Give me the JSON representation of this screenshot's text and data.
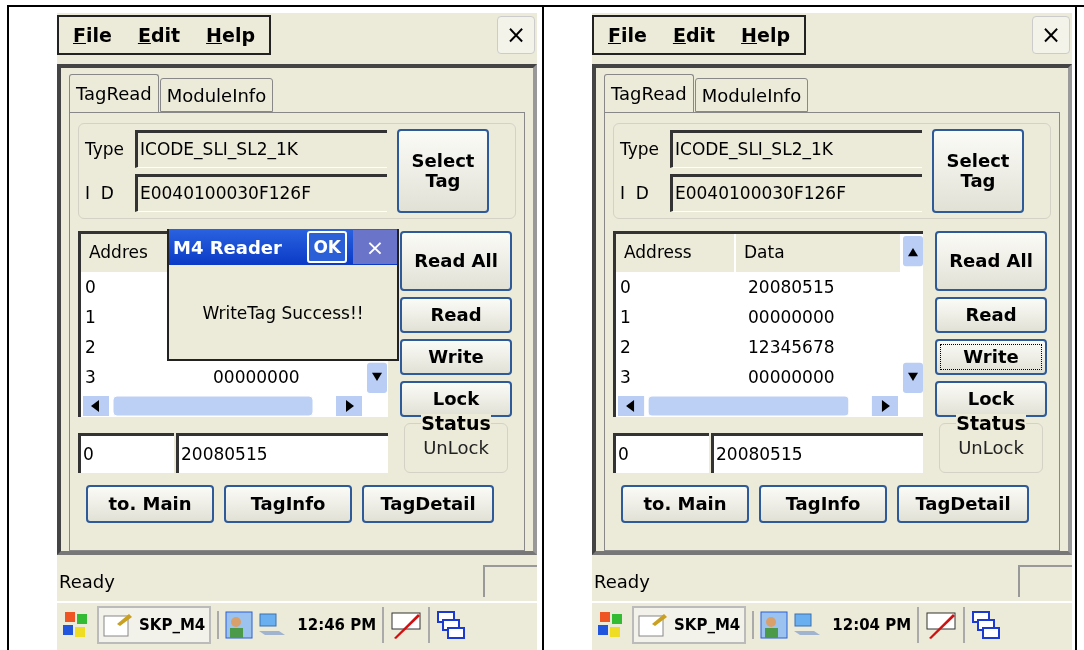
{
  "screens": [
    {
      "menu": [
        "File",
        "Edit",
        "Help"
      ],
      "close": "×",
      "tabs": [
        {
          "label": "TagRead",
          "selected": true
        },
        {
          "label": "ModuleInfo",
          "selected": false
        }
      ],
      "type_label": "Type",
      "type_value": "ICODE_SLI_SL2_1K",
      "id_label": "I  D",
      "id_value": "E0040100030F126F",
      "select_button": "Select Tag",
      "list": {
        "columns": [
          "Addres"
        ],
        "rows": [
          {
            "address": "0"
          },
          {
            "address": "1"
          },
          {
            "address": "2"
          },
          {
            "address": "3",
            "data": "00000000"
          }
        ]
      },
      "actions": [
        {
          "label": "Read All",
          "focused": false
        },
        {
          "label": "Read",
          "focused": false
        },
        {
          "label": "Write",
          "focused": false
        },
        {
          "label": "Lock",
          "focused": false
        }
      ],
      "status_label": "Status",
      "status_value": "UnLock",
      "address_field": "0",
      "data_field": "20080515",
      "bottom_buttons": [
        "to. Main",
        "TagInfo",
        "TagDetail"
      ],
      "status_bar": "Ready",
      "taskbar": {
        "app": "SKP_M4",
        "time": "12:46 PM"
      },
      "dialog": {
        "title": "M4 Reader",
        "ok": "OK",
        "close": "×",
        "message": "WriteTag Success!!"
      }
    },
    {
      "menu": [
        "File",
        "Edit",
        "Help"
      ],
      "close": "×",
      "tabs": [
        {
          "label": "TagRead",
          "selected": true
        },
        {
          "label": "ModuleInfo",
          "selected": false
        }
      ],
      "type_label": "Type",
      "type_value": "ICODE_SLI_SL2_1K",
      "id_label": "I  D",
      "id_value": "E0040100030F126F",
      "select_button": "Select Tag",
      "list": {
        "columns": [
          "Address",
          "Data"
        ],
        "rows": [
          {
            "address": "0",
            "data": "20080515"
          },
          {
            "address": "1",
            "data": "00000000"
          },
          {
            "address": "2",
            "data": "12345678"
          },
          {
            "address": "3",
            "data": "00000000"
          }
        ]
      },
      "actions": [
        {
          "label": "Read All",
          "focused": false
        },
        {
          "label": "Read",
          "focused": false
        },
        {
          "label": "Write",
          "focused": true
        },
        {
          "label": "Lock",
          "focused": false
        }
      ],
      "status_label": "Status",
      "status_value": "UnLock",
      "address_field": "0",
      "data_field": "20080515",
      "bottom_buttons": [
        "to. Main",
        "TagInfo",
        "TagDetail"
      ],
      "status_bar": "Ready",
      "taskbar": {
        "app": "SKP_M4",
        "time": "12:04 PM"
      }
    }
  ]
}
